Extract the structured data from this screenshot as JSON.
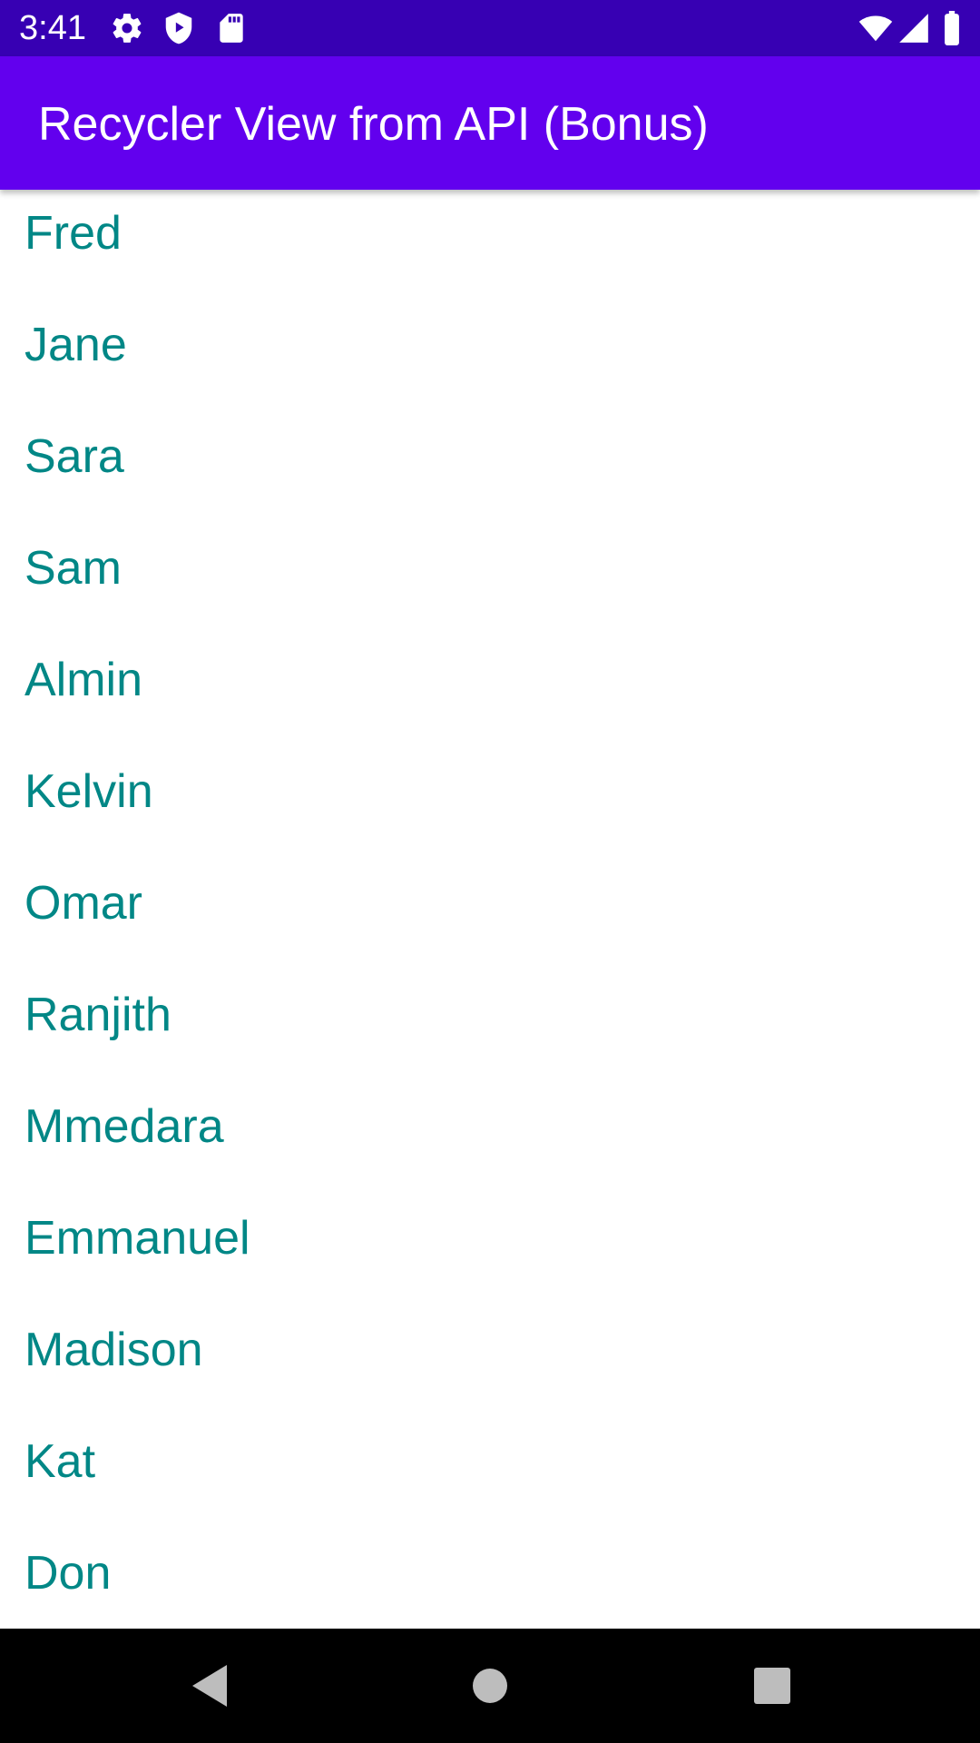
{
  "status_bar": {
    "time": "3:41",
    "icons_left": [
      "gear-icon",
      "shield-play-icon",
      "sd-card-icon"
    ],
    "icons_right": [
      "wifi-icon",
      "cell-signal-icon",
      "battery-icon"
    ],
    "background": "#3700b3"
  },
  "app_bar": {
    "title": "Recycler View from API (Bonus)",
    "background": "#6200ee"
  },
  "list": {
    "text_color": "#018786",
    "items": [
      {
        "label": "Fred"
      },
      {
        "label": "Jane"
      },
      {
        "label": "Sara"
      },
      {
        "label": "Sam"
      },
      {
        "label": "Almin"
      },
      {
        "label": "Kelvin"
      },
      {
        "label": "Omar"
      },
      {
        "label": "Ranjith"
      },
      {
        "label": "Mmedara"
      },
      {
        "label": "Emmanuel"
      },
      {
        "label": "Madison"
      },
      {
        "label": "Kat"
      },
      {
        "label": "Don"
      }
    ]
  },
  "nav_bar": {
    "buttons": [
      "back-icon",
      "home-icon",
      "recents-icon"
    ]
  }
}
